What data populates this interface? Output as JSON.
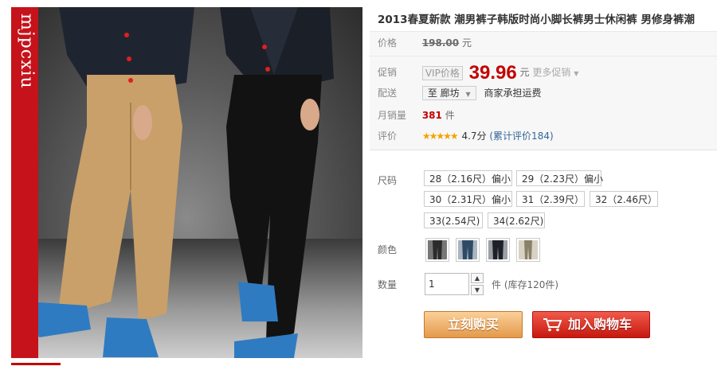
{
  "brand_watermark": "mjpcxiu",
  "product": {
    "title": "2013春夏新款 潮男裤子韩版时尚小脚长裤男士休闲裤 男修身裤潮"
  },
  "summary": {
    "price_label": "价格",
    "original_price": "198.00",
    "price_unit": "元",
    "promo_label": "促销",
    "vip_tag": "VIP价格",
    "promo_price": "39.96",
    "promo_unit": "元",
    "more_promo": "更多促销",
    "ship_label": "配送",
    "ship_dest": "至 廊坊",
    "ship_note": "商家承担运费",
    "monthly_label": "月销量",
    "monthly_sales": "381",
    "monthly_unit": "件",
    "review_label": "评价",
    "stars": "★★★★★",
    "score": "4.7分",
    "review_link": "(累计评价184)"
  },
  "options": {
    "size_label": "尺码",
    "sizes": [
      "28（2.16尺）偏小",
      "29（2.23尺）偏小",
      "30（2.31尺）偏小",
      "31（2.39尺）",
      "32（2.46尺）",
      "33(2.54尺)",
      "34(2.62尺)"
    ],
    "color_label": "颜色",
    "colors": [
      "#2b2b2b",
      "#2f4a66",
      "#1d2026",
      "#8a8068"
    ],
    "qty_label": "数量",
    "qty_value": "1",
    "qty_unit": "件 (库存120件)"
  },
  "actions": {
    "buy_now": "立刻购买",
    "add_cart": "加入购物车"
  },
  "colors": {
    "accent": "#c40000",
    "buy_button": "#e39a4b",
    "cart_button": "#c6180e"
  }
}
